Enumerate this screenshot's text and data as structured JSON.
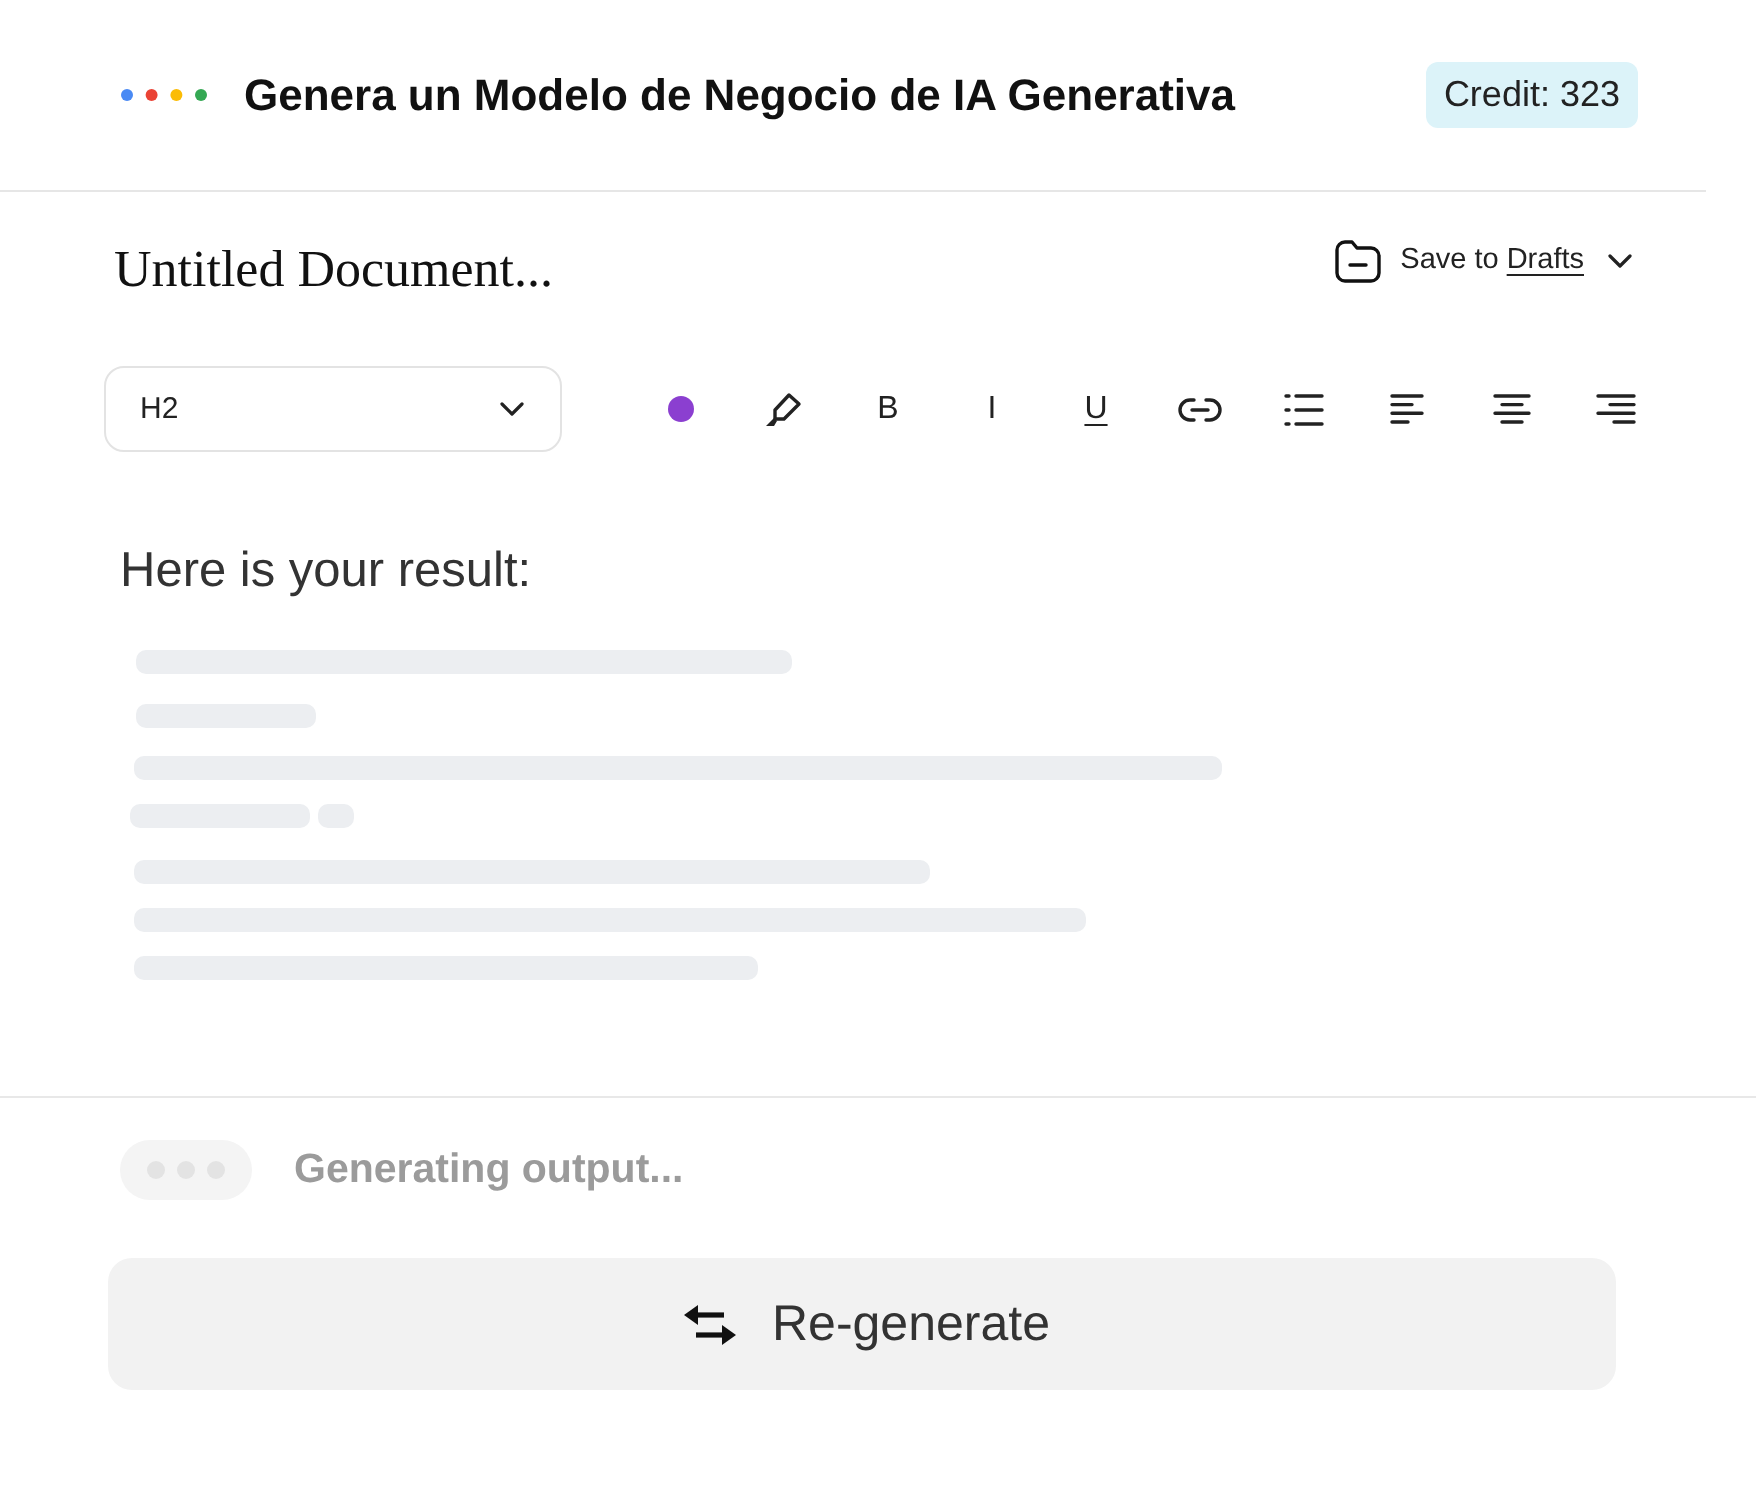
{
  "header": {
    "title": "Genera un Modelo de Negocio de IA Generativa",
    "credit": "Credit: 323"
  },
  "document": {
    "title": "Untitled Document...",
    "save": {
      "prefix": "Save to",
      "target": "Drafts"
    }
  },
  "toolbar": {
    "block_style": "H2",
    "tools": [
      {
        "kind": "color",
        "color": "#8b3fd0"
      },
      {
        "kind": "highlight"
      },
      {
        "kind": "bold",
        "label": "B"
      },
      {
        "kind": "italic",
        "label": "I"
      },
      {
        "kind": "underline",
        "label": "U"
      },
      {
        "kind": "link"
      },
      {
        "kind": "bullet-list"
      },
      {
        "kind": "align-left"
      },
      {
        "kind": "align-center"
      },
      {
        "kind": "align-right"
      }
    ]
  },
  "result": {
    "heading": "Here is your result:",
    "loading": true
  },
  "status": {
    "text": "Generating output...",
    "busy": true
  },
  "actions": {
    "regenerate": "Re-generate"
  }
}
